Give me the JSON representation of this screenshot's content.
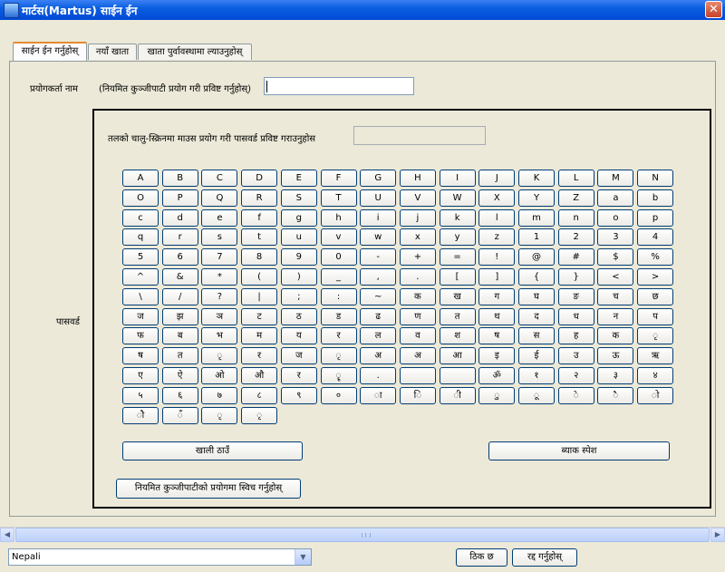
{
  "window": {
    "title": "मार्टस(Martus) साईन ईन",
    "close_glyph": "✕",
    "app_icon": "martus-app-icon"
  },
  "tabs": [
    {
      "label": "साईन ईन गर्नुहोस्",
      "active": true
    },
    {
      "label": "नयाँ खाता",
      "active": false
    },
    {
      "label": "खाता पुर्वावस्थामा ल्याउनुहोस्",
      "active": false
    }
  ],
  "username": {
    "label": "प्रयोगकर्ता नाम",
    "hint": "(नियमित कुञ्जीपाटी प्रयोग गरी प्रविष्ट गर्नुहोस्)",
    "value": ""
  },
  "password": {
    "label": "पासवर्ड",
    "instruction": "तलको चालु-स्क्रिनमा माउस प्रयोग गरी पासवर्ड प्रविष्ट गराउनुहोस",
    "display_value": ""
  },
  "keyboard": {
    "rows": [
      [
        "A",
        "B",
        "C",
        "D",
        "E",
        "F",
        "G",
        "H",
        "I",
        "J",
        "K",
        "L",
        "M",
        "N"
      ],
      [
        "O",
        "P",
        "Q",
        "R",
        "S",
        "T",
        "U",
        "V",
        "W",
        "X",
        "Y",
        "Z",
        "a",
        "b"
      ],
      [
        "c",
        "d",
        "e",
        "f",
        "g",
        "h",
        "i",
        "j",
        "k",
        "l",
        "m",
        "n",
        "o",
        "p"
      ],
      [
        "q",
        "r",
        "s",
        "t",
        "u",
        "v",
        "w",
        "x",
        "y",
        "z",
        "1",
        "2",
        "3",
        "4"
      ],
      [
        "5",
        "6",
        "7",
        "8",
        "9",
        "0",
        "-",
        "+",
        "=",
        "!",
        "@",
        "#",
        "$",
        "%"
      ],
      [
        "^",
        "&",
        "*",
        "(",
        ")",
        "_",
        ",",
        ".",
        "[",
        "]",
        "{",
        "}",
        "<",
        ">"
      ],
      [
        "\\",
        "/",
        "?",
        "|",
        ";",
        ":",
        "~",
        "क",
        "ख",
        "ग",
        "घ",
        "ङ",
        "च",
        "छ"
      ],
      [
        "ज",
        "झ",
        "ञ",
        "ट",
        "ठ",
        "ड",
        "ढ",
        "ण",
        "त",
        "थ",
        "द",
        "ध",
        "न",
        "प"
      ],
      [
        "फ",
        "ब",
        "भ",
        "म",
        "य",
        "र",
        "ल",
        "व",
        "श",
        "ष",
        "स",
        "ह",
        "क",
        "ृ"
      ],
      [
        "ष",
        "त",
        "ृ",
        "र",
        "ज",
        "ृ",
        "अ",
        "अ",
        "आ",
        "इ",
        "ई",
        "उ",
        "ऊ",
        "ऋ"
      ],
      [
        "ए",
        "ऐ",
        "ओ",
        "औ",
        "र",
        "ॄ",
        ".",
        "",
        "",
        "ॐ",
        "१",
        "२",
        "३",
        "४"
      ],
      [
        "५",
        "६",
        "७",
        "८",
        "९",
        "०",
        "ा",
        "ि",
        "ी",
        "ु",
        "ू",
        "े",
        "ै",
        "ो"
      ],
      [
        "ौ",
        "ँ",
        "ृ",
        "ृ"
      ]
    ],
    "clear_label": "खाली ठाउँ",
    "backspace_label": "ब्याक स्पेश"
  },
  "switch_keyboard_label": "नियमित कुञ्जीपाटीको प्रयोगमा स्विच गर्नुहोस्",
  "scrollbar": {
    "left_arrow": "◀",
    "right_arrow": "▶"
  },
  "language_select": {
    "value": "Nepali",
    "arrow": "▼"
  },
  "ok_label": "ठिक छ",
  "cancel_label": "रद्द गर्नुहोस्"
}
